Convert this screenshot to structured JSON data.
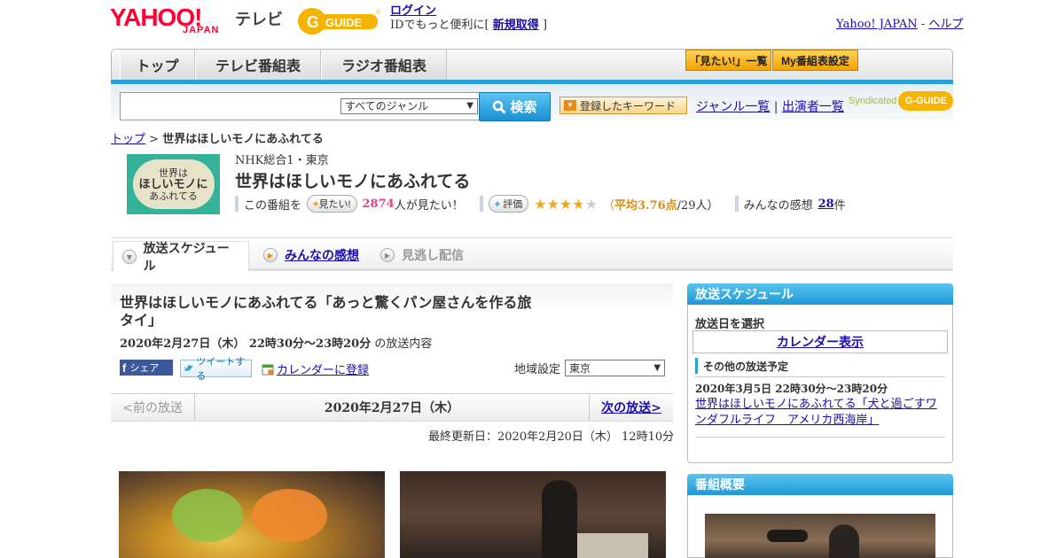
{
  "header": {
    "logo_yahoo": "YAHOO!",
    "logo_japan": "JAPAN",
    "logo_tv": "テレビ",
    "gguide_logo": "G-GUIDE",
    "login_link": "ログイン",
    "login_text_prefix": "IDでもっと便利に[",
    "signup_link": "新規取得",
    "login_text_suffix": "]",
    "yahoo_japan_link": "Yahoo! JAPAN",
    "separator": "-",
    "help_link": "ヘルプ"
  },
  "nav": {
    "tabs": [
      "トップ",
      "テレビ番組表",
      "ラジオ番組表"
    ],
    "want_list_button": "「見たい!」一覧",
    "my_schedule_button": "My番組表設定"
  },
  "search": {
    "input_value": "",
    "genre_select": "すべてのジャンル",
    "search_button": "検索",
    "keyword_button": "登録したキーワード",
    "genre_list_link": "ジャンル一覧",
    "divider": "|",
    "cast_list_link": "出演者一覧",
    "syndicated": "Syndicated"
  },
  "breadcrumb": {
    "top_link": "トップ",
    "separator": ">",
    "current": "世界はほしいモノにあふれてる"
  },
  "program": {
    "thumb_text_1": "世界は",
    "thumb_text_2": "ほしいモノに",
    "thumb_text_3": "あふれてる",
    "channel": "NHK総合1・東京",
    "title": "世界はほしいモノにあふれてる",
    "this_program_label": "この番組を",
    "want_button": "見たい!",
    "want_count": "2874",
    "want_suffix": "人が見たい！",
    "rate_button": "評価",
    "rating_open": "（",
    "rating_avg_label": "平均3.76点",
    "rating_count": "/29人）",
    "rating_value": 3.76,
    "rating_max": 5,
    "impressions_label": "みんなの感想",
    "impressions_count": "28",
    "impressions_unit": "件"
  },
  "page_tabs": {
    "schedule": "放送スケジュール",
    "impressions": "みんなの感想",
    "missed": "見逃し配信"
  },
  "episode": {
    "title": "世界はほしいモノにあふれてる「あっと驚くパン屋さんを作る旅　タイ」",
    "date": "2020年2月27日（木）  22時30分～23時20分",
    "date_suffix": "の放送内容",
    "fb_share": "シェア",
    "tweet": "ツイートする",
    "calendar_register": "カレンダーに登録",
    "region_label": "地域設定",
    "region_value": "東京",
    "prev": "<前の放送",
    "current_date": "2020年2月27日（木）",
    "next": "次の放送>",
    "updated": "最終更新日：2020年2月20日（木）  12時10分"
  },
  "sidebar": {
    "schedule_header": "放送スケジュール",
    "select_date_label": "放送日を選択",
    "calendar_link": "カレンダー表示",
    "other_header": "その他の放送予定",
    "other_date": "2020年3月5日  22時30分～23時20分",
    "other_link": "世界はほしいモノにあふれてる「犬と過ごすワンダフルライフ　アメリカ西海岸」",
    "overview_header": "番組概要"
  },
  "colors": {
    "accent_blue": "#2aa0d8",
    "yahoo_red": "#ff0033",
    "want_pink": "#e8428a",
    "rating_orange": "#d98c10"
  }
}
